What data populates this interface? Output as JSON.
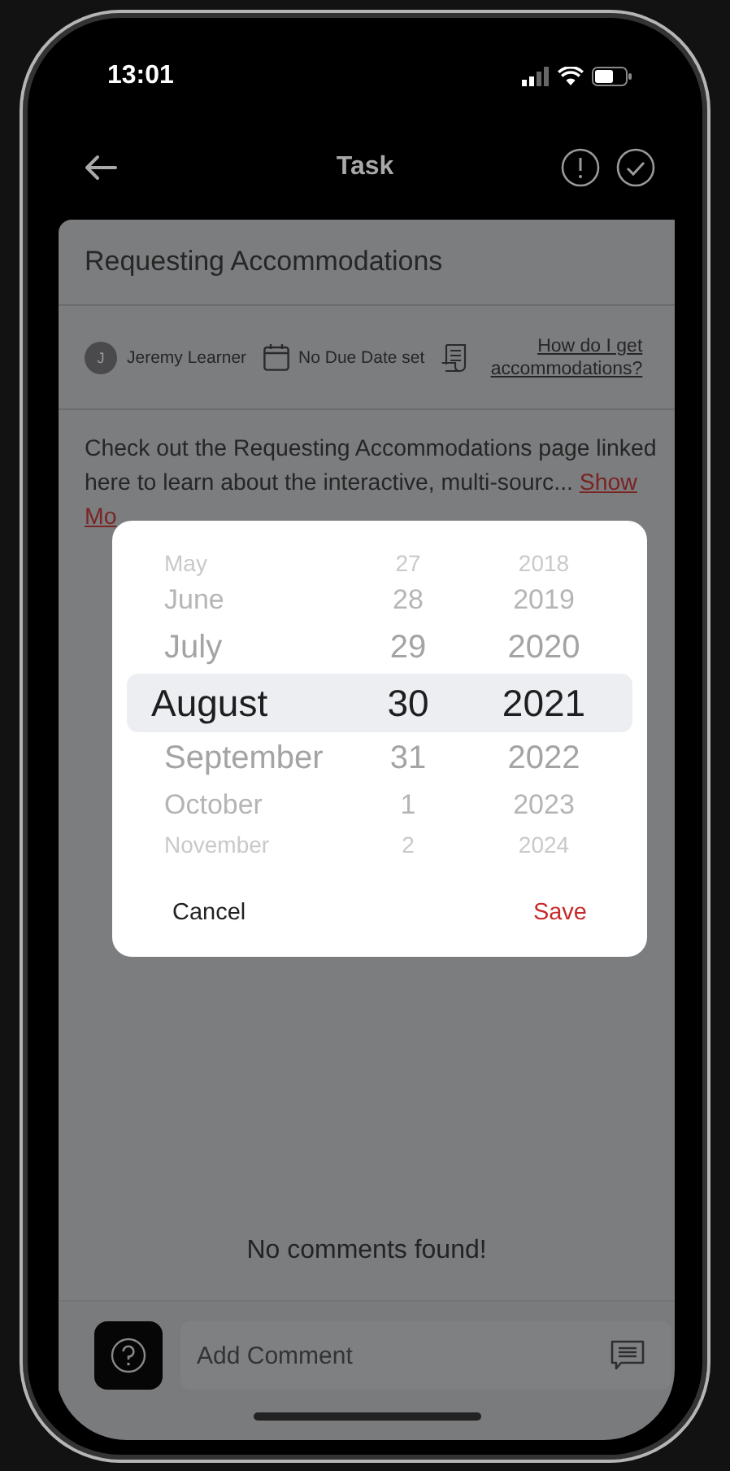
{
  "status_bar": {
    "time": "13:01"
  },
  "nav": {
    "title": "Task"
  },
  "task": {
    "title": "Requesting Accommodations",
    "assignee": {
      "initial": "J",
      "name": "Jeremy Learner"
    },
    "due": "No Due Date set",
    "resource_link": "How do I get accommodations?",
    "description": "Check out the Requesting Accommodations page linked here to learn about the interactive, multi-sourc...",
    "more_link": [
      "Show",
      "Mo"
    ]
  },
  "comments": {
    "empty_text": "No comments found!"
  },
  "comment_field": {
    "placeholder": "Add Comment"
  },
  "date_picker": {
    "columns": [
      {
        "kind": "month",
        "items": [
          {
            "label": "May",
            "selected": false
          },
          {
            "label": "June",
            "selected": false
          },
          {
            "label": "July",
            "selected": false
          },
          {
            "label": "August",
            "selected": true
          },
          {
            "label": "September",
            "selected": false
          },
          {
            "label": "October",
            "selected": false
          },
          {
            "label": "November",
            "selected": false
          }
        ]
      },
      {
        "kind": "day",
        "items": [
          {
            "label": "27",
            "selected": false
          },
          {
            "label": "28",
            "selected": false
          },
          {
            "label": "29",
            "selected": false
          },
          {
            "label": "30",
            "selected": true
          },
          {
            "label": "31",
            "selected": false
          },
          {
            "label": "1",
            "selected": false
          },
          {
            "label": "2",
            "selected": false
          }
        ]
      },
      {
        "kind": "year",
        "items": [
          {
            "label": "2018",
            "selected": false
          },
          {
            "label": "2019",
            "selected": false
          },
          {
            "label": "2020",
            "selected": false
          },
          {
            "label": "2021",
            "selected": true
          },
          {
            "label": "2022",
            "selected": false
          },
          {
            "label": "2023",
            "selected": false
          },
          {
            "label": "2024",
            "selected": false
          }
        ]
      }
    ],
    "buttons": [
      {
        "kind": "cancel",
        "label": "Cancel"
      },
      {
        "kind": "save",
        "label": "Save"
      }
    ]
  }
}
